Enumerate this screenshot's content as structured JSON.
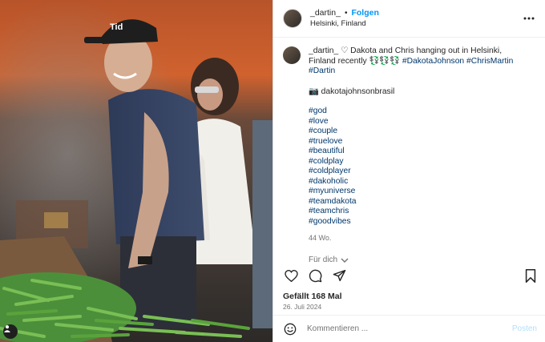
{
  "post": {
    "username": "_dartin_",
    "separator": "•",
    "follow_label": "Folgen",
    "location": "Helsinki, Finland",
    "more_icon": "more-horizontal-icon"
  },
  "caption": {
    "username": "_dartin_",
    "text": " ♡ Dakota and Chris hanging out in Helsinki, Finland recently 💱💱💱 ",
    "inline_tags": [
      "#DakotaJohnson",
      "#ChrisMartin",
      "#Dartin"
    ],
    "credit": "📷 dakotajohnsonbrasil",
    "hashtags": [
      "#god",
      "#love",
      "#couple",
      "#truelove",
      "#beautiful",
      "#coldplay",
      "#coldplayer",
      "#dakoholic",
      "#myuniverse",
      "#teamdakota",
      "#teamchris",
      "#goodvibes"
    ],
    "age": "44 Wo.",
    "translate_label": "Für dich"
  },
  "actions": {
    "like_icon": "heart-icon",
    "comment_icon": "comment-icon",
    "share_icon": "send-icon",
    "save_icon": "bookmark-icon"
  },
  "likes": "Gefällt 168 Mal",
  "date": "26. Juli 2024",
  "comment_box": {
    "emoji_icon": "emoji-icon",
    "placeholder": "Kommentieren ...",
    "post_label": "Posten"
  },
  "colors": {
    "accent": "#0095f6",
    "hashtag": "#00376b",
    "muted": "#737373",
    "post_disabled": "#b2dffc"
  }
}
